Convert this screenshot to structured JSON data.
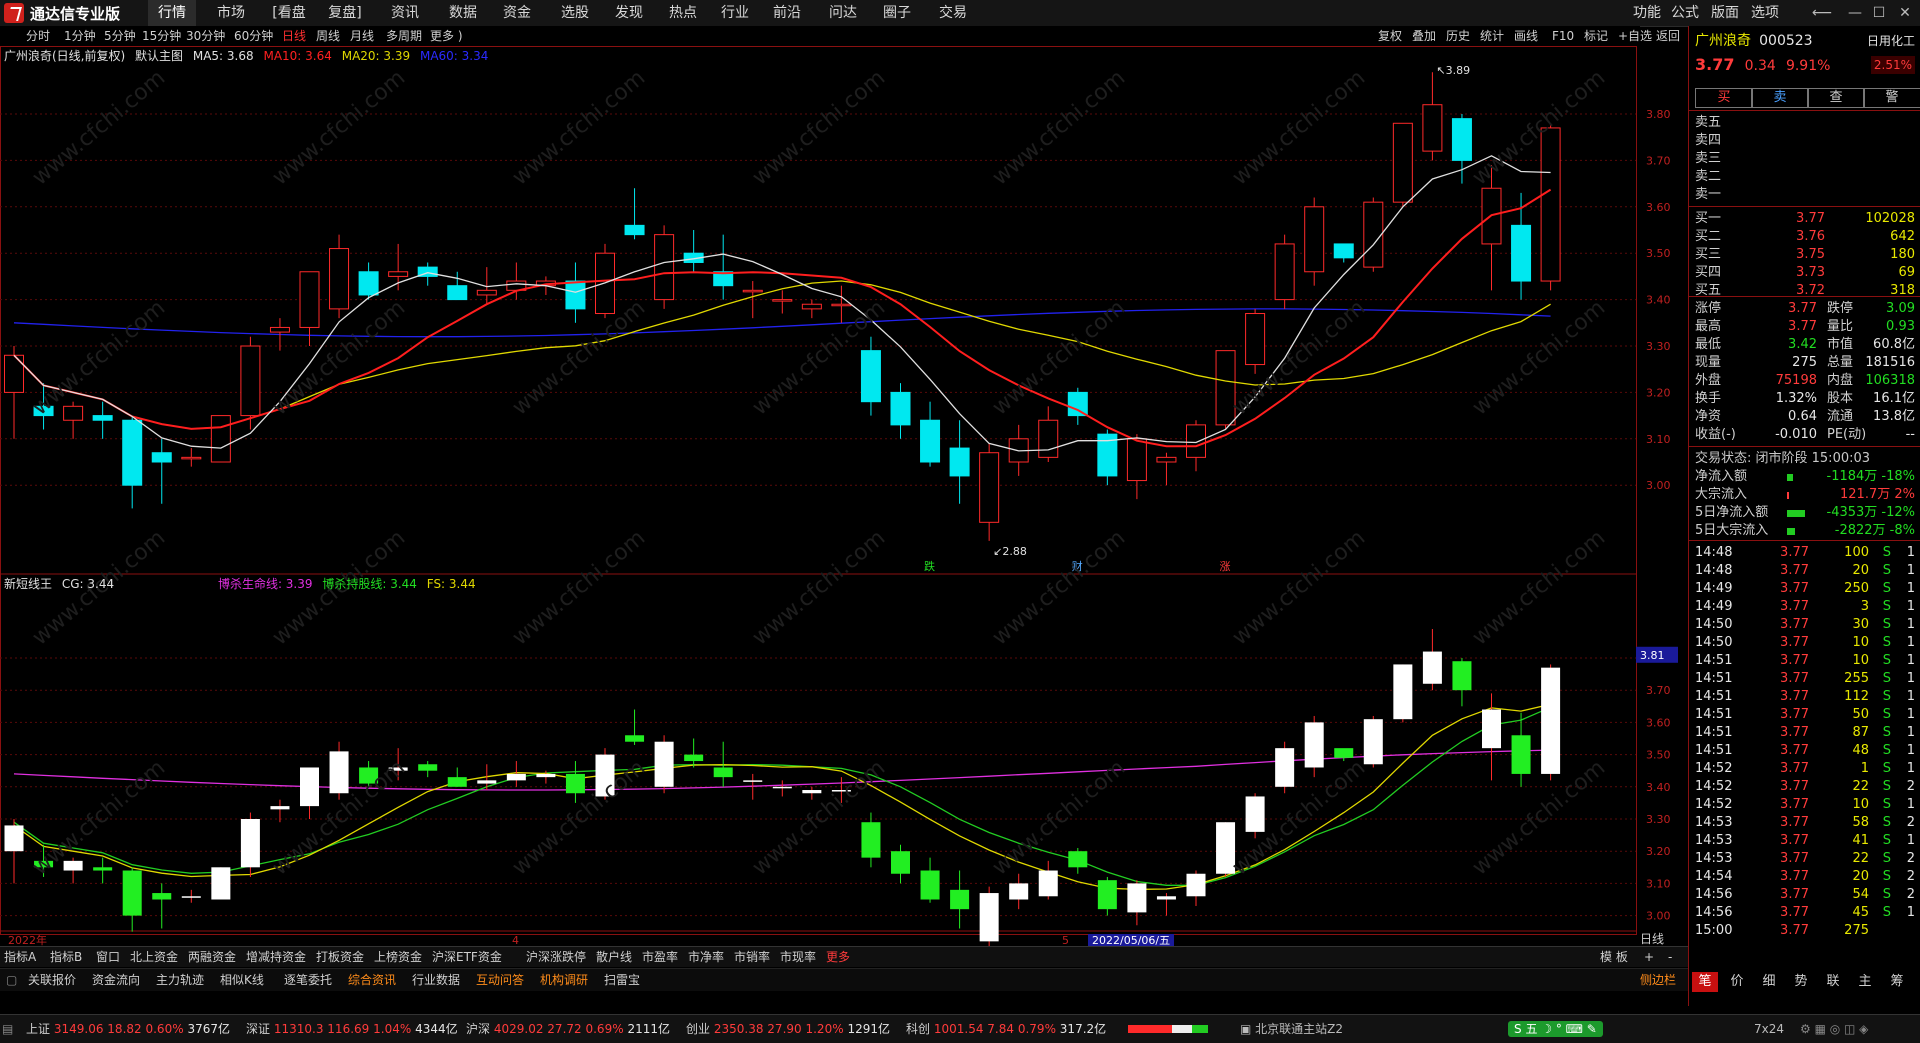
{
  "app": {
    "title": "通达信专业版"
  },
  "menu": [
    "行情",
    "市场",
    "[看盘",
    "复盘]",
    "资讯",
    "数据",
    "资金",
    "选股",
    "发现",
    "热点",
    "行业",
    "前沿",
    "问达",
    "圈子",
    "交易"
  ],
  "menu_right": [
    "功能",
    "公式",
    "版面",
    "选项"
  ],
  "periods": [
    "分时",
    "1分钟",
    "5分钟",
    "15分钟",
    "30分钟",
    "60分钟",
    "日线",
    "周线",
    "月线",
    "多周期",
    "更多 )"
  ],
  "tools": [
    "复权",
    "叠加",
    "历史",
    "统计",
    "画线",
    "F10",
    "标记",
    "+自选",
    "返回"
  ],
  "main_header": {
    "stock": "广州浪奇(日线,前复权)",
    "template": "默认主图",
    "ma5": "MA5: 3.68",
    "ma10": "MA10: 3.64",
    "ma20": "MA20: 3.39",
    "ma60": "MA60: 3.34"
  },
  "sub_header": {
    "name": "新短线王",
    "cg": "CG: 3.44",
    "line1": "博杀生命线: 3.39",
    "line2": "博杀持股线: 3.44",
    "fs": "FS: 3.44"
  },
  "colors": {
    "up": "#ff2a2a",
    "down": "#00e8f0",
    "ma5": "#e0e0e0",
    "ma10": "#ff1e1e",
    "ma20": "#e0d800",
    "ma60": "#2222ee",
    "sub_up": "#ffffff",
    "sub_down": "#22ee22",
    "lifeline": "#e030e0",
    "holdline": "#e0d800",
    "fsline": "#22cc22"
  },
  "chart_data": {
    "type": "candlestick",
    "y_ticks_main": [
      "3.80",
      "3.70",
      "3.60",
      "3.50",
      "3.40",
      "3.30",
      "3.20",
      "3.10",
      "3.00"
    ],
    "y_ticks_sub": [
      "3.80",
      "3.70",
      "3.60",
      "3.50",
      "3.40",
      "3.30",
      "3.20",
      "3.10",
      "3.00"
    ],
    "price_label": "3.81",
    "high_label": "3.89",
    "low_label": "2.88",
    "x_labels": [
      "2022年",
      "4",
      "5"
    ],
    "cursor_date": "2022/05/06/五",
    "events": [
      "跌",
      "财",
      "涨"
    ],
    "candles": [
      {
        "o": 3.2,
        "h": 3.3,
        "l": 3.1,
        "c": 3.28
      },
      {
        "o": 3.17,
        "h": 3.22,
        "l": 3.12,
        "c": 3.15
      },
      {
        "o": 3.14,
        "h": 3.18,
        "l": 3.1,
        "c": 3.17
      },
      {
        "o": 3.15,
        "h": 3.18,
        "l": 3.1,
        "c": 3.14
      },
      {
        "o": 3.14,
        "h": 3.15,
        "l": 2.95,
        "c": 3.0
      },
      {
        "o": 3.07,
        "h": 3.1,
        "l": 2.96,
        "c": 3.05
      },
      {
        "o": 3.06,
        "h": 3.08,
        "l": 3.04,
        "c": 3.06
      },
      {
        "o": 3.05,
        "h": 3.15,
        "l": 3.05,
        "c": 3.15
      },
      {
        "o": 3.15,
        "h": 3.32,
        "l": 3.12,
        "c": 3.3
      },
      {
        "o": 3.33,
        "h": 3.36,
        "l": 3.29,
        "c": 3.34
      },
      {
        "o": 3.34,
        "h": 3.46,
        "l": 3.3,
        "c": 3.46
      },
      {
        "o": 3.38,
        "h": 3.54,
        "l": 3.36,
        "c": 3.51
      },
      {
        "o": 3.46,
        "h": 3.48,
        "l": 3.4,
        "c": 3.41
      },
      {
        "o": 3.45,
        "h": 3.52,
        "l": 3.42,
        "c": 3.46
      },
      {
        "o": 3.47,
        "h": 3.48,
        "l": 3.43,
        "c": 3.45
      },
      {
        "o": 3.43,
        "h": 3.46,
        "l": 3.4,
        "c": 3.4
      },
      {
        "o": 3.41,
        "h": 3.47,
        "l": 3.39,
        "c": 3.42
      },
      {
        "o": 3.42,
        "h": 3.48,
        "l": 3.4,
        "c": 3.44
      },
      {
        "o": 3.43,
        "h": 3.45,
        "l": 3.41,
        "c": 3.44
      },
      {
        "o": 3.44,
        "h": 3.48,
        "l": 3.35,
        "c": 3.38
      },
      {
        "o": 3.37,
        "h": 3.52,
        "l": 3.36,
        "c": 3.5
      },
      {
        "o": 3.56,
        "h": 3.64,
        "l": 3.53,
        "c": 3.54
      },
      {
        "o": 3.4,
        "h": 3.56,
        "l": 3.38,
        "c": 3.54
      },
      {
        "o": 3.5,
        "h": 3.55,
        "l": 3.46,
        "c": 3.48
      },
      {
        "o": 3.46,
        "h": 3.54,
        "l": 3.4,
        "c": 3.43
      },
      {
        "o": 3.42,
        "h": 3.44,
        "l": 3.36,
        "c": 3.42
      },
      {
        "o": 3.4,
        "h": 3.42,
        "l": 3.37,
        "c": 3.4
      },
      {
        "o": 3.38,
        "h": 3.4,
        "l": 3.36,
        "c": 3.39
      },
      {
        "o": 3.39,
        "h": 3.43,
        "l": 3.35,
        "c": 3.39
      },
      {
        "o": 3.29,
        "h": 3.32,
        "l": 3.15,
        "c": 3.18
      },
      {
        "o": 3.2,
        "h": 3.22,
        "l": 3.1,
        "c": 3.13
      },
      {
        "o": 3.14,
        "h": 3.18,
        "l": 3.04,
        "c": 3.05
      },
      {
        "o": 3.08,
        "h": 3.14,
        "l": 2.96,
        "c": 3.02
      },
      {
        "o": 2.92,
        "h": 3.09,
        "l": 2.88,
        "c": 3.07
      },
      {
        "o": 3.05,
        "h": 3.13,
        "l": 3.02,
        "c": 3.1
      },
      {
        "o": 3.06,
        "h": 3.17,
        "l": 3.05,
        "c": 3.14
      },
      {
        "o": 3.2,
        "h": 3.21,
        "l": 3.13,
        "c": 3.15
      },
      {
        "o": 3.11,
        "h": 3.12,
        "l": 3.0,
        "c": 3.02
      },
      {
        "o": 3.01,
        "h": 3.11,
        "l": 2.97,
        "c": 3.1
      },
      {
        "o": 3.05,
        "h": 3.07,
        "l": 3.0,
        "c": 3.06
      },
      {
        "o": 3.06,
        "h": 3.14,
        "l": 3.03,
        "c": 3.13
      },
      {
        "o": 3.13,
        "h": 3.29,
        "l": 3.12,
        "c": 3.29
      },
      {
        "o": 3.26,
        "h": 3.38,
        "l": 3.24,
        "c": 3.37
      },
      {
        "o": 3.4,
        "h": 3.54,
        "l": 3.38,
        "c": 3.52
      },
      {
        "o": 3.46,
        "h": 3.62,
        "l": 3.43,
        "c": 3.6
      },
      {
        "o": 3.52,
        "h": 3.5,
        "l": 3.48,
        "c": 3.49
      },
      {
        "o": 3.47,
        "h": 3.62,
        "l": 3.46,
        "c": 3.61
      },
      {
        "o": 3.61,
        "h": 3.78,
        "l": 3.6,
        "c": 3.78
      },
      {
        "o": 3.72,
        "h": 3.89,
        "l": 3.7,
        "c": 3.82
      },
      {
        "o": 3.79,
        "h": 3.8,
        "l": 3.65,
        "c": 3.7
      },
      {
        "o": 3.52,
        "h": 3.69,
        "l": 3.42,
        "c": 3.64
      },
      {
        "o": 3.56,
        "h": 3.63,
        "l": 3.4,
        "c": 3.44
      },
      {
        "o": 3.44,
        "h": 3.78,
        "l": 3.42,
        "c": 3.77
      }
    ]
  },
  "quote": {
    "name": "广州浪奇",
    "code": "000523",
    "industry": "日用化工",
    "price": "3.77",
    "change": "0.34",
    "pct": "9.91%",
    "amp": "2.51%",
    "buttons": [
      "买",
      "卖",
      "查",
      "警"
    ],
    "sell": [
      {
        "l": "卖五",
        "p": "",
        "v": ""
      },
      {
        "l": "卖四",
        "p": "",
        "v": ""
      },
      {
        "l": "卖三",
        "p": "",
        "v": ""
      },
      {
        "l": "卖二",
        "p": "",
        "v": ""
      },
      {
        "l": "卖一",
        "p": "",
        "v": ""
      }
    ],
    "buy": [
      {
        "l": "买一",
        "p": "3.77",
        "v": "102028"
      },
      {
        "l": "买二",
        "p": "3.76",
        "v": "642"
      },
      {
        "l": "买三",
        "p": "3.75",
        "v": "180"
      },
      {
        "l": "买四",
        "p": "3.73",
        "v": "69"
      },
      {
        "l": "买五",
        "p": "3.72",
        "v": "318"
      }
    ],
    "stats": [
      {
        "l1": "涨停",
        "v1": "3.77",
        "c1": "red",
        "l2": "跌停",
        "v2": "3.09",
        "c2": "green"
      },
      {
        "l1": "最高",
        "v1": "3.77",
        "c1": "red",
        "l2": "量比",
        "v2": "0.93",
        "c2": "green"
      },
      {
        "l1": "最低",
        "v1": "3.42",
        "c1": "green",
        "l2": "市值",
        "v2": "60.8亿",
        "c2": "white"
      },
      {
        "l1": "现量",
        "v1": "275",
        "c1": "white",
        "l2": "总量",
        "v2": "181516",
        "c2": "white"
      },
      {
        "l1": "外盘",
        "v1": "75198",
        "c1": "red",
        "l2": "内盘",
        "v2": "106318",
        "c2": "green"
      },
      {
        "l1": "换手",
        "v1": "1.32%",
        "c1": "white",
        "l2": "股本",
        "v2": "16.1亿",
        "c2": "white"
      },
      {
        "l1": "净资",
        "v1": "0.64",
        "c1": "white",
        "l2": "流通",
        "v2": "13.8亿",
        "c2": "white"
      },
      {
        "l1": "收益(-)",
        "v1": "-0.010",
        "c1": "white",
        "l2": "PE(动)",
        "v2": "--",
        "c2": "white"
      }
    ],
    "status": "交易状态: 闭市阶段 15:00:03",
    "flows": [
      {
        "l": "净流入额",
        "v": "-1184万 -18%",
        "c": "green"
      },
      {
        "l": "大宗流入",
        "v": "121.7万  2%",
        "c": "red"
      },
      {
        "l": "5日净流入额",
        "v": "-4353万 -12%",
        "c": "green"
      },
      {
        "l": "5日大宗流入",
        "v": "-2822万  -8%",
        "c": "green"
      }
    ],
    "ticks": [
      {
        "t": "14:48",
        "p": "3.77",
        "v": "100",
        "s": "S",
        "n": "1"
      },
      {
        "t": "14:48",
        "p": "3.77",
        "v": "20",
        "s": "S",
        "n": "1"
      },
      {
        "t": "14:49",
        "p": "3.77",
        "v": "250",
        "s": "S",
        "n": "1"
      },
      {
        "t": "14:49",
        "p": "3.77",
        "v": "3",
        "s": "S",
        "n": "1"
      },
      {
        "t": "14:50",
        "p": "3.77",
        "v": "30",
        "s": "S",
        "n": "1"
      },
      {
        "t": "14:50",
        "p": "3.77",
        "v": "10",
        "s": "S",
        "n": "1"
      },
      {
        "t": "14:51",
        "p": "3.77",
        "v": "10",
        "s": "S",
        "n": "1"
      },
      {
        "t": "14:51",
        "p": "3.77",
        "v": "255",
        "s": "S",
        "n": "1"
      },
      {
        "t": "14:51",
        "p": "3.77",
        "v": "112",
        "s": "S",
        "n": "1"
      },
      {
        "t": "14:51",
        "p": "3.77",
        "v": "50",
        "s": "S",
        "n": "1"
      },
      {
        "t": "14:51",
        "p": "3.77",
        "v": "87",
        "s": "S",
        "n": "1"
      },
      {
        "t": "14:51",
        "p": "3.77",
        "v": "48",
        "s": "S",
        "n": "1"
      },
      {
        "t": "14:52",
        "p": "3.77",
        "v": "1",
        "s": "S",
        "n": "1"
      },
      {
        "t": "14:52",
        "p": "3.77",
        "v": "22",
        "s": "S",
        "n": "2"
      },
      {
        "t": "14:52",
        "p": "3.77",
        "v": "10",
        "s": "S",
        "n": "1"
      },
      {
        "t": "14:53",
        "p": "3.77",
        "v": "58",
        "s": "S",
        "n": "2"
      },
      {
        "t": "14:53",
        "p": "3.77",
        "v": "41",
        "s": "S",
        "n": "1"
      },
      {
        "t": "14:53",
        "p": "3.77",
        "v": "22",
        "s": "S",
        "n": "2"
      },
      {
        "t": "14:54",
        "p": "3.77",
        "v": "20",
        "s": "S",
        "n": "2"
      },
      {
        "t": "14:56",
        "p": "3.77",
        "v": "54",
        "s": "S",
        "n": "2"
      },
      {
        "t": "14:56",
        "p": "3.77",
        "v": "45",
        "s": "S",
        "n": "1"
      },
      {
        "t": "15:00",
        "p": "3.77",
        "v": "275",
        "s": "",
        "n": ""
      }
    ],
    "right_tabs": [
      "笔",
      "价",
      "细",
      "势",
      "联",
      "主",
      "筹"
    ]
  },
  "tabs_row1": [
    "指标A",
    "指标B",
    "窗口",
    "北上资金",
    "两融资金",
    "增减持资金",
    "打板资金",
    "上榜资金",
    "沪深ETF资金",
    "沪深涨跌停",
    "散户线",
    "市盈率",
    "市净率",
    "市销率",
    "市现率",
    "更多"
  ],
  "tabs_row1_right": [
    "模 板",
    "+",
    "-"
  ],
  "period_label": "日线",
  "tabs_row2": [
    "关联报价",
    "资金流向",
    "主力轨迹",
    "相似K线",
    "逐笔委托",
    "综合资讯",
    "行业数据",
    "互动问答",
    "机构调研",
    "扫雷宝"
  ],
  "tabs_row2_right": "侧边栏",
  "statusbar": {
    "sh_label": "上证",
    "sh_val": "3149.06",
    "sh_chg": "18.82",
    "sh_pct": "0.60%",
    "sh_amt": "3767亿",
    "sz_label": "深证",
    "sz_val": "11310.3",
    "sz_chg": "116.69",
    "sz_pct": "1.04%",
    "sz_amt": "4344亿",
    "hs_label": "沪深",
    "hs_val": "4029.02",
    "hs_chg": "27.72",
    "hs_pct": "0.69%",
    "hs_amt": "2111亿",
    "cy_label": "创业",
    "cy_val": "2350.38",
    "cy_chg": "27.90",
    "cy_pct": "1.20%",
    "cy_amt": "1291亿",
    "kc_label": "科创",
    "kc_val": "1001.54",
    "kc_chg": "7.84",
    "kc_pct": "0.79%",
    "kc_amt": "317.2亿",
    "server": "北京联通主站Z2",
    "session": "7x24",
    "ime": "五"
  }
}
